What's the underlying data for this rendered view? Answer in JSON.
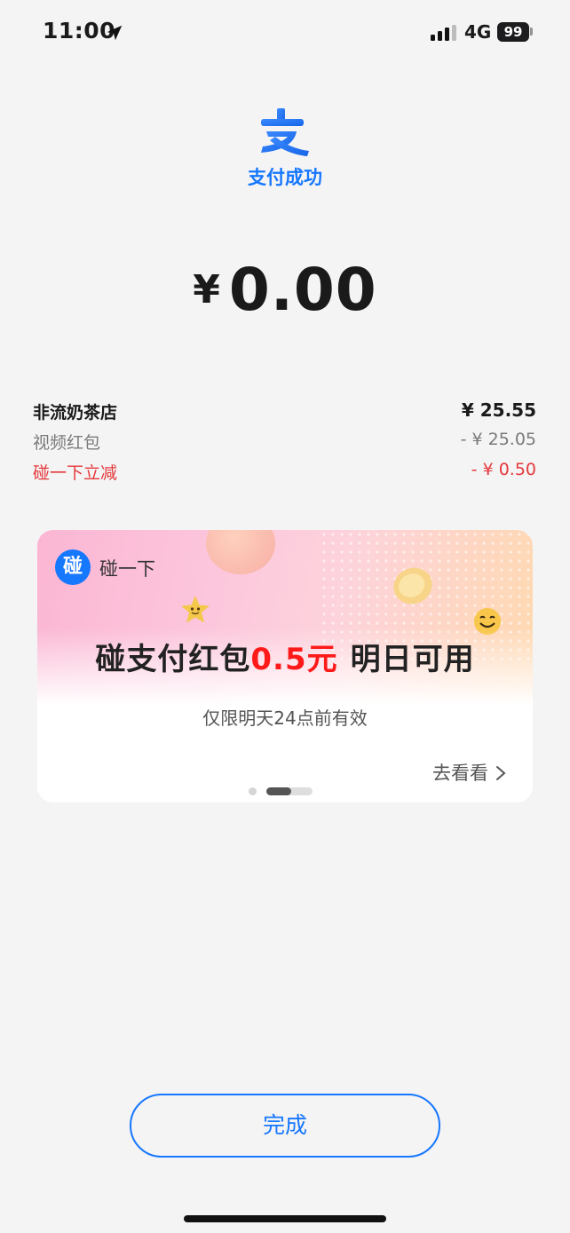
{
  "status_bar": {
    "time": "11:00",
    "network": "4G",
    "battery": "99"
  },
  "header": {
    "title": "支付成功",
    "logo_icon": "alipay-logo",
    "accent_color": "#1677ff"
  },
  "amount": {
    "currency": "¥",
    "value": "0.00"
  },
  "details": {
    "merchant": {
      "label": "非流奶茶店",
      "value": "¥ 25.55"
    },
    "video_red_packet": {
      "label": "视频红包",
      "value": "- ¥ 25.05"
    },
    "bump_discount": {
      "label": "碰一下立减",
      "value": "- ¥ 0.50",
      "color": "#e5383b"
    }
  },
  "promo": {
    "brand_icon_char": "碰",
    "brand_name": "碰一下",
    "headline_prefix": "碰支付红包",
    "headline_amount": "0.5元",
    "headline_suffix": "明日可用",
    "subtitle": "仅限明天24点前有效",
    "link_label": "去看看",
    "amount_color": "#ff1a1a"
  },
  "actions": {
    "done_label": "完成"
  }
}
